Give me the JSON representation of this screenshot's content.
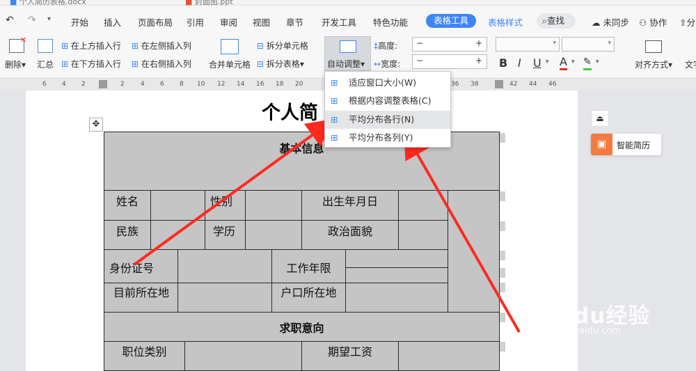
{
  "doc_tabs": [
    "个人简历表格.docx",
    "封面图.ppt"
  ],
  "menu": [
    "开始",
    "插入",
    "页面布局",
    "引用",
    "审阅",
    "视图",
    "章节",
    "开发工具",
    "特色功能"
  ],
  "active_tab": "表格工具",
  "table_style_tab": "表格样式",
  "search_label": "查找",
  "sync_label": "未同步",
  "collab_label": "协作",
  "share_label": "分",
  "ribbon": {
    "delete": "删除",
    "summary": "汇总",
    "insert_above": "在上方插入行",
    "insert_below": "在下方插入行",
    "insert_left": "在左侧插入列",
    "insert_right": "在右侧插入列",
    "merge": "合并单元格",
    "split_cell": "拆分单元格",
    "split_table": "拆分表格",
    "auto_adjust": "自动调整",
    "height": "高度:",
    "width": "宽度:",
    "align": "对齐方式",
    "text": "文字",
    "bold": "B",
    "italic": "I",
    "underline": "U",
    "font_color": "A"
  },
  "ruler": [
    "6",
    "4",
    "2",
    "2",
    "4",
    "6",
    "8",
    "10",
    "12",
    "14",
    "16",
    "18",
    "20",
    "22",
    "36",
    "38",
    "42",
    "44",
    "46"
  ],
  "dropdown": [
    "适应窗口大小(W)",
    "根据内容调整表格(C)",
    "平均分布各行(N)",
    "平均分布各列(Y)"
  ],
  "doc_title": "个人简",
  "table": {
    "section1": "基本信息",
    "name": "姓名",
    "gender": "性别",
    "birth": "出生年月日",
    "ethnic": "民族",
    "education": "学历",
    "political": "政治面貌",
    "id_no": "身份证号",
    "work_years": "工作年限",
    "location": "目前所在地",
    "hukou": "户口所在地",
    "section2": "求职意向",
    "job_type": "职位类别",
    "salary": "期望工资"
  },
  "smart_resume": "智能简历",
  "watermark": {
    "brand": "Baidu经验",
    "url": "jingyan.baidu.com"
  },
  "colors": {
    "accent": "#3d86f5",
    "arrow": "#ff2a1f",
    "cell_bg": "#c5c5c5",
    "smart_icon": "#f47b3f"
  }
}
